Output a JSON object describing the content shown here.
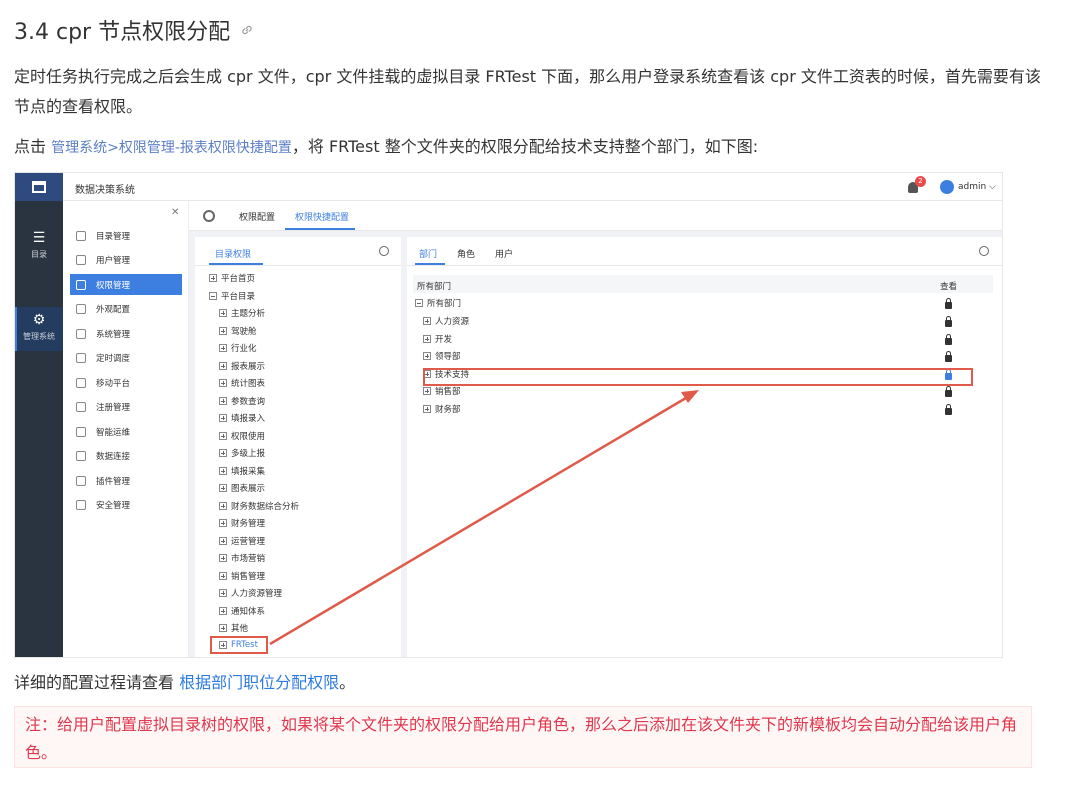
{
  "doc": {
    "title": "3.4 cpr 节点权限分配",
    "p1": "定时任务执行完成之后会生成 cpr 文件，cpr 文件挂载的虚拟目录 FRTest 下面，那么用户登录系统查看该 cpr 文件工资表的时候，首先需要有该节点的查看权限。",
    "p2_pre": "点击 ",
    "p2_link": "管理系统>权限管理-报表权限快捷配置",
    "p2_post": "，将 FRTest 整个文件夹的权限分配给技术支持整个部门，如下图:",
    "p3_pre": "详细的配置过程请查看 ",
    "p3_link": "根据部门职位分配权限",
    "p3_post": "。",
    "note": "注：给用户配置虚拟目录树的权限，如果将某个文件夹的权限分配给用户角色，那么之后添加在该文件夹下的新模板均会自动分配给该用户角色。"
  },
  "app": {
    "title": "数据决策系统",
    "badge": "2",
    "user": "admin ⌵",
    "leftnav": [
      {
        "label": "目录",
        "icon": "list-icon"
      },
      {
        "label": "管理系统",
        "icon": "gear-icon"
      }
    ],
    "menu": [
      "目录管理",
      "用户管理",
      "权限管理",
      "外观配置",
      "系统管理",
      "定时调度",
      "移动平台",
      "注册管理",
      "智能运维",
      "数据连接",
      "插件管理",
      "安全管理"
    ],
    "tabs": [
      "权限配置",
      "权限快捷配置"
    ],
    "left_panel_tab": "目录权限",
    "tree_root": [
      "平台首页",
      "平台目录"
    ],
    "tree_children": [
      "主题分析",
      "驾驶舱",
      "行业化",
      "报表展示",
      "统计图表",
      "参数查询",
      "填报录入",
      "权限使用",
      "多级上报",
      "填报采集",
      "图表展示",
      "财务数据综合分析",
      "财务管理",
      "运营管理",
      "市场营销",
      "销售管理",
      "人力资源管理",
      "通知体系",
      "其他",
      "FRTest"
    ],
    "right_tabs": [
      "部门",
      "角色",
      "用户"
    ],
    "header_col1": "所有部门",
    "header_col2": "查看",
    "dept_root": "所有部门",
    "depts": [
      "人力资源",
      "开发",
      "领导部",
      "技术支持",
      "销售部",
      "财务部"
    ]
  }
}
